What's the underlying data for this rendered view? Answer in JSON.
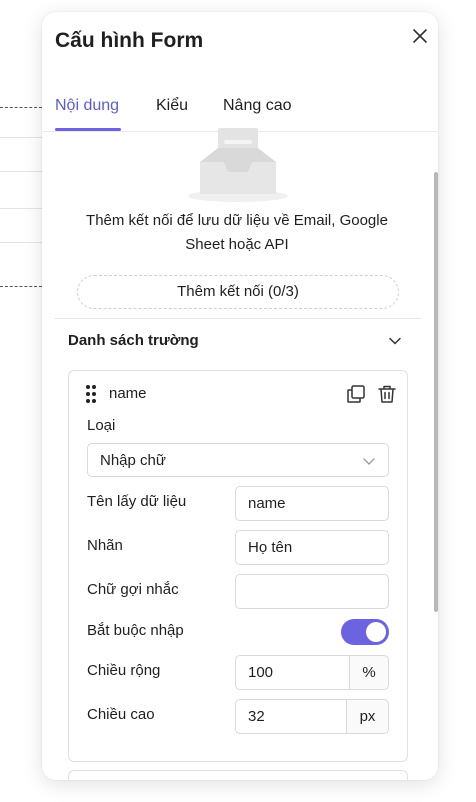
{
  "panel": {
    "title": "Cấu hình Form",
    "close_icon": "close-icon"
  },
  "tabs": [
    {
      "label": "Nội dung",
      "active": true
    },
    {
      "label": "Kiểu",
      "active": false
    },
    {
      "label": "Nâng cao",
      "active": false
    }
  ],
  "connections": {
    "description_line1": "Thêm kết nối để lưu dữ liệu về Email, Google",
    "description_line2": "Sheet hoặc API",
    "add_button": "Thêm kết nối (0/3)"
  },
  "fields_section": {
    "title": "Danh sách trường",
    "field": {
      "name": "name",
      "type_label": "Loại",
      "type_value": "Nhập chữ",
      "data_key_label": "Tên lấy dữ liệu",
      "data_key_value": "name",
      "label_label": "Nhãn",
      "label_value": "Họ tên",
      "placeholder_label": "Chữ gợi nhắc",
      "placeholder_value": "",
      "required_label": "Bắt buộc nhập",
      "required": true,
      "width_label": "Chiều rộng",
      "width_value": "100",
      "width_unit": "%",
      "height_label": "Chiều cao",
      "height_value": "32",
      "height_unit": "px"
    }
  },
  "colors": {
    "accent": "#6b63e0",
    "active_tab": "#5b5bd6"
  }
}
